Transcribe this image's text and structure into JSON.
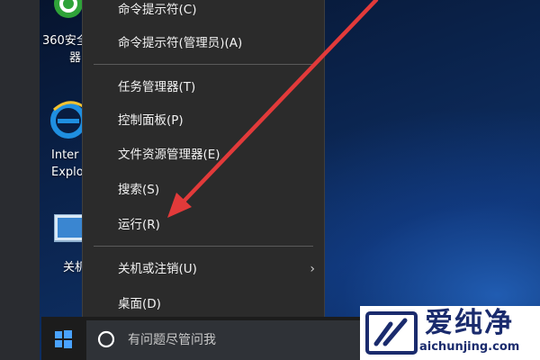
{
  "desktop": {
    "icons": [
      {
        "name": "360-safe-icon",
        "label_lines": [
          "360安全",
          "器"
        ]
      },
      {
        "name": "ie-icon",
        "label_lines": [
          "Inter",
          "Explo"
        ]
      },
      {
        "name": "this-pc-icon",
        "label_lines": [
          "关机"
        ]
      }
    ]
  },
  "context_menu": {
    "items": [
      {
        "label": "命令提示符(C)"
      },
      {
        "label": "命令提示符(管理员)(A)"
      },
      {
        "label": "任务管理器(T)"
      },
      {
        "label": "控制面板(P)"
      },
      {
        "label": "文件资源管理器(E)"
      },
      {
        "label": "搜索(S)"
      },
      {
        "label": "运行(R)"
      },
      {
        "label": "关机或注销(U)",
        "has_submenu": true,
        "submenu_glyph": "›"
      },
      {
        "label": "桌面(D)"
      }
    ]
  },
  "taskbar": {
    "search_placeholder": "有问题尽管问我"
  },
  "watermark": {
    "title": "爱纯净",
    "url": "aichunjing.com"
  },
  "colors": {
    "menu_bg": "#2b2b2b",
    "menu_text": "#f2f2f2",
    "arrow": "#e23a3a",
    "watermark_text": "#1a2b6d"
  }
}
